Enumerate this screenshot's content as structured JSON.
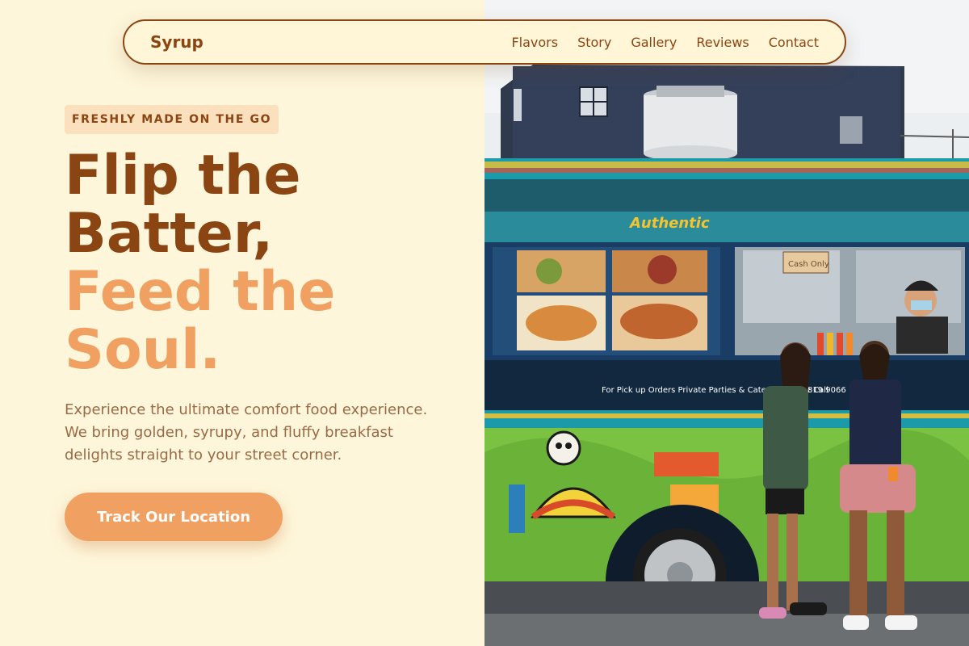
{
  "nav": {
    "logo": "Syrup",
    "links": [
      "Flavors",
      "Story",
      "Gallery",
      "Reviews",
      "Contact"
    ]
  },
  "hero": {
    "badge": "FRESHLY MADE ON THE GO",
    "headline_line1": "Flip the",
    "headline_line2": "Batter,",
    "headline_line3": "Feed the",
    "headline_line4": "Soul.",
    "description": "Experience the ultimate comfort food experience. We bring golden, syrupy, and fluffy breakfast delights straight to your street corner.",
    "cta_label": "Track Our Location"
  },
  "image": {
    "alt": "food-truck-photo",
    "truck_sign": "Authentic",
    "truck_banner": "For Pick up Orders Private Parties & Catering Please Call",
    "truck_phone": "819 9066",
    "menu_sign": "Cash Only"
  },
  "colors": {
    "brand_brown": "#8B4513",
    "accent_orange": "#F0A060",
    "background_cream": "#FEF6DA",
    "badge_bg": "#FBE0BE",
    "body_text": "#9A6A46"
  }
}
